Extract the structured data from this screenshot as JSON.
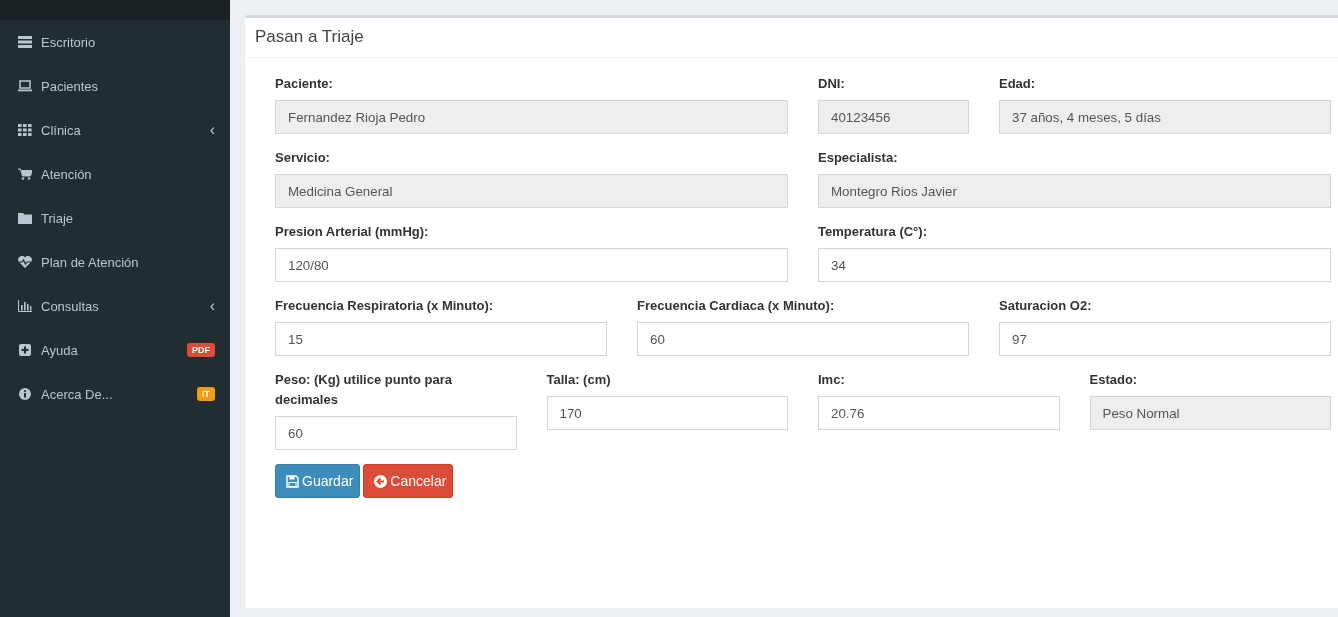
{
  "sidebar": {
    "items": [
      {
        "label": "Escritorio"
      },
      {
        "label": "Pacientes"
      },
      {
        "label": "Clínica",
        "caret": "‹"
      },
      {
        "label": "Atención"
      },
      {
        "label": "Triaje"
      },
      {
        "label": "Plan de Atención"
      },
      {
        "label": "Consultas",
        "caret": "‹"
      },
      {
        "label": "Ayuda",
        "badge": "PDF",
        "color": "#dd4b39"
      },
      {
        "label": "Acerca De...",
        "badge": "IT",
        "color": "#f39c12"
      }
    ]
  },
  "card": {
    "title": "Pasan a Triaje",
    "fields": [
      {
        "label": "Paciente:",
        "value": "Fernandez Rioja Pedro",
        "disabled": true
      },
      {
        "label": "DNI:",
        "value": "40123456",
        "disabled": true
      },
      {
        "label": "Edad:",
        "value": "37 años, 4 meses, 5 días",
        "disabled": true
      },
      {
        "label": "Servicio:",
        "value": "Medicina General",
        "disabled": true
      },
      {
        "label": "Especialista:",
        "value": "Montegro Rios Javier",
        "disabled": true
      },
      {
        "label": "Presion Arterial (mmHg):",
        "value": "120/80",
        "disabled": false
      },
      {
        "label": "Temperatura (C°):",
        "value": "34",
        "disabled": false
      },
      {
        "label": "Frecuencia Respiratoria (x Minuto):",
        "value": "15",
        "disabled": false
      },
      {
        "label": "Frecuencia Cardiaca (x Minuto):",
        "value": "60",
        "disabled": false
      },
      {
        "label": "Saturacion O2:",
        "value": "97",
        "disabled": false
      },
      {
        "label": "Peso: (Kg) utilice punto para decimales",
        "value": "60",
        "disabled": false
      },
      {
        "label": "Talla: (cm)",
        "value": "170",
        "disabled": false
      },
      {
        "label": "Imc:",
        "value": "20.76",
        "disabled": false
      },
      {
        "label": "Estado:",
        "value": "Peso Normal",
        "disabled": true
      }
    ],
    "buttons": [
      {
        "label": "Guardar",
        "kind": "primary"
      },
      {
        "label": "Cancelar",
        "kind": "danger"
      }
    ]
  }
}
